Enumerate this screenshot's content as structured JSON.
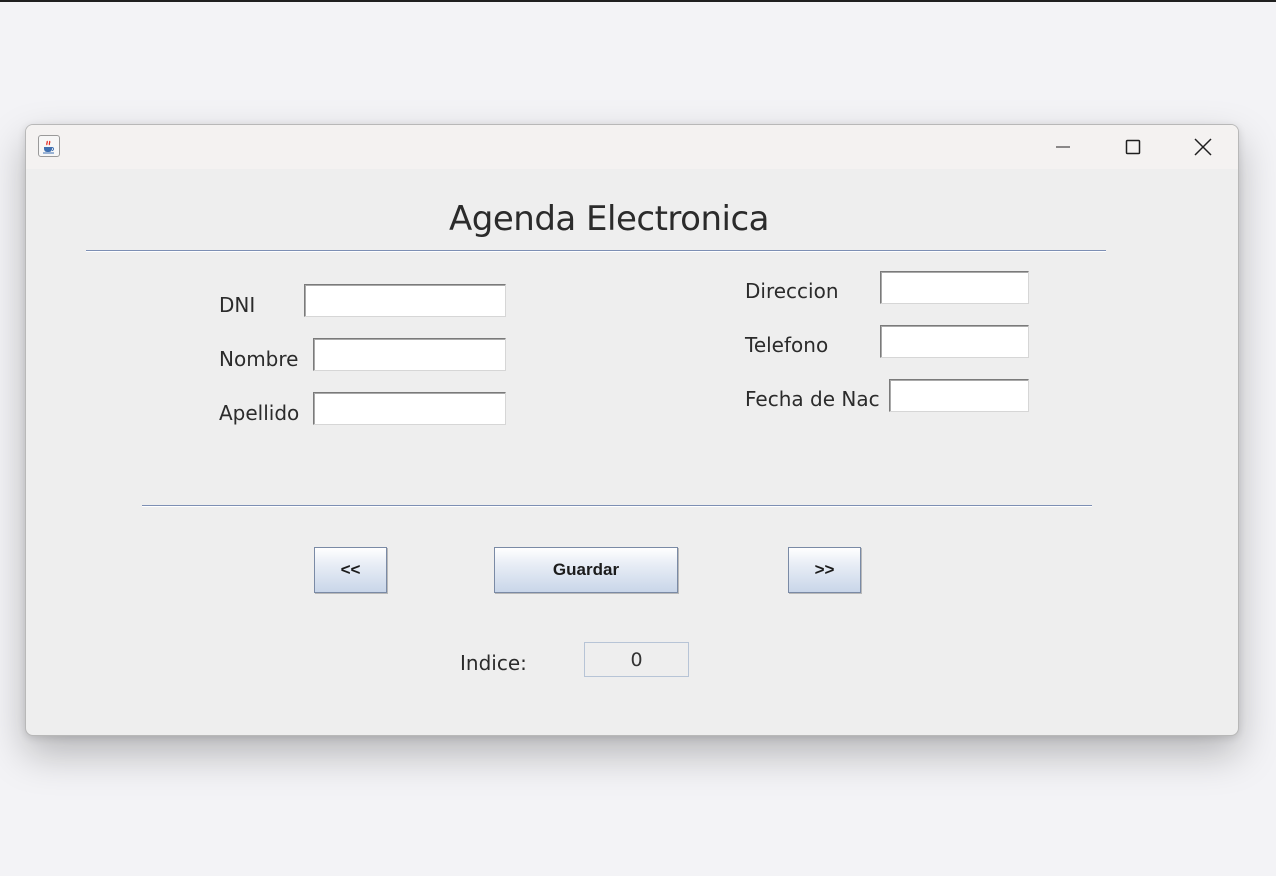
{
  "window": {
    "heading": "Agenda Electronica"
  },
  "form": {
    "dni_label": "DNI",
    "nombre_label": "Nombre",
    "apellido_label": "Apellido",
    "direccion_label": "Direccion",
    "telefono_label": "Telefono",
    "fecha_label": "Fecha de Nac",
    "dni_value": "",
    "nombre_value": "",
    "apellido_value": "",
    "direccion_value": "",
    "telefono_value": "",
    "fecha_value": ""
  },
  "nav": {
    "prev_label": "<<",
    "save_label": "Guardar",
    "next_label": ">>"
  },
  "index": {
    "label": "Indice:",
    "value": "0"
  },
  "icons": {
    "app": "java-coffee-icon",
    "minimize": "minimize-icon",
    "maximize": "maximize-icon",
    "close": "close-icon"
  },
  "colors": {
    "separator": "#7d8fb4",
    "button_gradient_bottom": "#c9d6e9",
    "java_icon_red": "#e2231a",
    "java_icon_blue": "#3e6fb0"
  }
}
